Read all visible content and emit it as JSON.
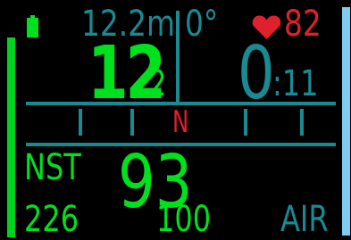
{
  "top": {
    "depth_small": "12.2m",
    "heading": "0°",
    "heart_rate": "82"
  },
  "main": {
    "depth_int": "12",
    "depth_dec": ".2",
    "time_min": "0",
    "time_sec": ":11"
  },
  "compass": {
    "north_label": "N"
  },
  "ndl": {
    "label": "NST",
    "value": "93"
  },
  "bottom": {
    "pressure": "226",
    "o2": "100",
    "gas": "AIR"
  },
  "colors": {
    "green": "#00e11e",
    "teal": "#1a8a92",
    "red": "#e0202c",
    "blue_bar": "#7fcdf2",
    "background": "#000000"
  },
  "icons": {
    "battery": "battery-icon",
    "heart": "heart-icon"
  }
}
